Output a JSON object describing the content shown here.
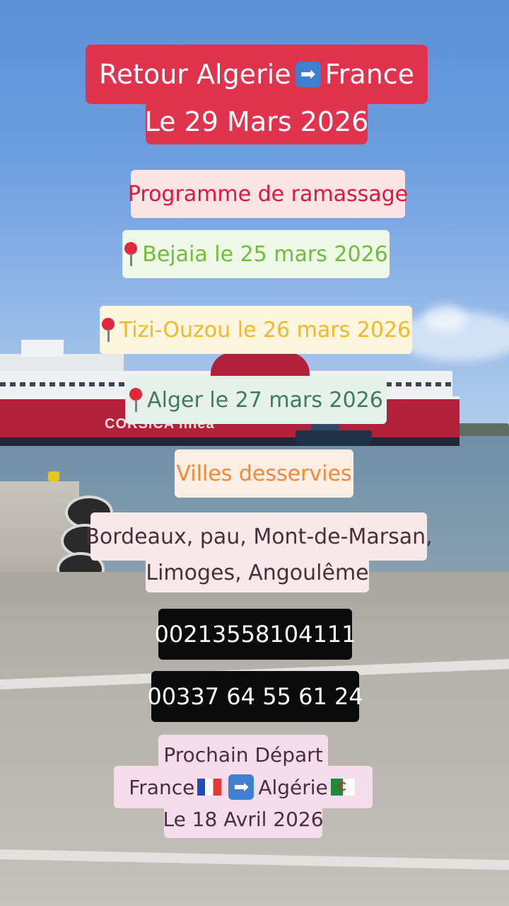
{
  "title": {
    "line1_prefix": "Retour Algerie",
    "arrow": "➡",
    "line1_suffix": "France",
    "line2": "Le 29 Mars 2026",
    "bg": "#e0334d",
    "color": "#ffffff"
  },
  "pickup": {
    "heading": "Programme de ramassage",
    "heading_color": "#d91a3c",
    "stops": [
      {
        "text": "Bejaia le 25 mars 2026",
        "color": "#6fbd3a"
      },
      {
        "text": "Tizi-Ouzou le 26 mars 2026",
        "color": "#f1b92a"
      },
      {
        "text": "Alger le 27 mars 2026",
        "color": "#3f7a5a"
      }
    ]
  },
  "cities": {
    "heading": "Villes desservies",
    "heading_color": "#ee8a3a",
    "line1": "Bordeaux, pau, Mont-de-Marsan,",
    "line2": "Limoges, Angoulême"
  },
  "phones": [
    "00213558104111",
    "00337 64 55 61 24"
  ],
  "next_departure": {
    "line1": "Prochain Départ",
    "from": "France",
    "to": "Algérie",
    "date": "Le 18 Avril 2026"
  },
  "ship_name": "CORSICA linea"
}
